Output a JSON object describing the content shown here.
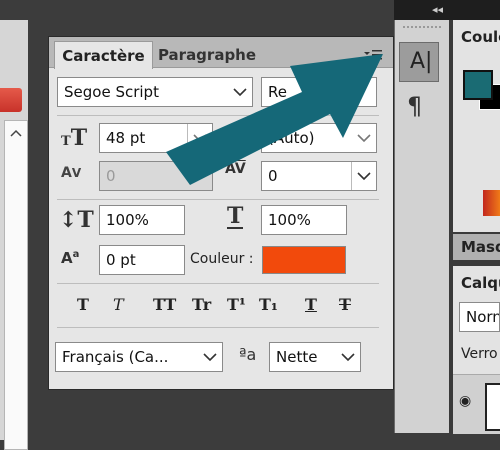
{
  "window_title": "Caractère",
  "char_panel": {
    "tabs": [
      "Caractère",
      "Paragraphe"
    ],
    "font_family": "Segoe Script",
    "font_style": "Re",
    "font_size": "48 pt",
    "leading": "(Auto)",
    "kerning": "0",
    "tracking": "0",
    "vertical_scale": "100%",
    "horizontal_scale": "100%",
    "baseline_shift": "0 pt",
    "color_label": "Couleur :",
    "color_swatch": "#f24a0c",
    "style_buttons": [
      "T",
      "T",
      "TT",
      "Tr",
      "T¹",
      "T₁",
      "T",
      "T"
    ],
    "language": "Français (Ca...",
    "antialias_icon": "ªa",
    "antialias": "Nette"
  },
  "right_panels": {
    "color_tab": "Coule",
    "masks_tab": "Masq",
    "layers_tab": "Calqu",
    "blend_mode": "Norn",
    "lock_label": "Verro"
  },
  "colors": {
    "arrow": "#156878",
    "foreground_swatch": "#1a6b73",
    "panel_bg": "#e6e6e6",
    "accent_red": "#f24a0c"
  }
}
